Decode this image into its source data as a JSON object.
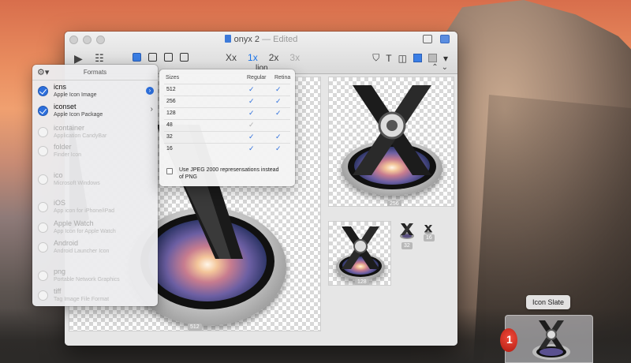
{
  "window": {
    "title": "onyx 2",
    "title_separator": "—",
    "status": "Edited"
  },
  "toolbar": {
    "scale_options": [
      "Xx",
      "1x",
      "2x",
      "3x"
    ],
    "active_scale": "1x"
  },
  "path_bar": {
    "label": "lion"
  },
  "tiles": [
    {
      "label": "512"
    },
    {
      "label": "256"
    },
    {
      "label": "128"
    },
    {
      "label": "32"
    },
    {
      "label": "16"
    }
  ],
  "formats_panel": {
    "title": "Formats",
    "items": [
      {
        "name": "icns",
        "subtitle": "Apple Icon Image",
        "enabled": true
      },
      {
        "name": "iconset",
        "subtitle": "Apple Icon Package",
        "enabled": true
      },
      {
        "name": "icontainer",
        "subtitle": "Application CandyBar",
        "enabled": false
      },
      {
        "name": "folder",
        "subtitle": "Finder Icon",
        "enabled": false
      },
      {
        "name": "ico",
        "subtitle": "Microsoft Windows",
        "enabled": false
      },
      {
        "name": "iOS",
        "subtitle": "App icon for iPhone/iPad",
        "enabled": false
      },
      {
        "name": "Apple Watch",
        "subtitle": "App Icon for Apple Watch",
        "enabled": false
      },
      {
        "name": "Android",
        "subtitle": "Android Launcher Icon",
        "enabled": false
      },
      {
        "name": "png",
        "subtitle": "Portable Network Graphics",
        "enabled": false
      },
      {
        "name": "tiff",
        "subtitle": "Tag Image File Format",
        "enabled": false
      }
    ]
  },
  "sizes_panel": {
    "header_sizes": "Sizes",
    "header_regular": "Regular",
    "header_retina": "Retina",
    "rows": [
      {
        "size": "512",
        "regular": true,
        "retina": true,
        "regular_dim": false
      },
      {
        "size": "256",
        "regular": true,
        "retina": true,
        "regular_dim": false
      },
      {
        "size": "128",
        "regular": true,
        "retina": true,
        "regular_dim": false
      },
      {
        "size": "48",
        "regular": true,
        "retina": false,
        "regular_dim": true
      },
      {
        "size": "32",
        "regular": true,
        "retina": true,
        "regular_dim": false
      },
      {
        "size": "16",
        "regular": true,
        "retina": true,
        "regular_dim": false
      }
    ],
    "check_glyph": "✓",
    "jpeg_option": "Use JPEG 2000 represensations instead of PNG",
    "jpeg_checked": false
  },
  "dock": {
    "tooltip": "Icon Slate",
    "badge": "1"
  },
  "colors": {
    "accent": "#2d6fdc",
    "window_bg": "#ececec"
  }
}
